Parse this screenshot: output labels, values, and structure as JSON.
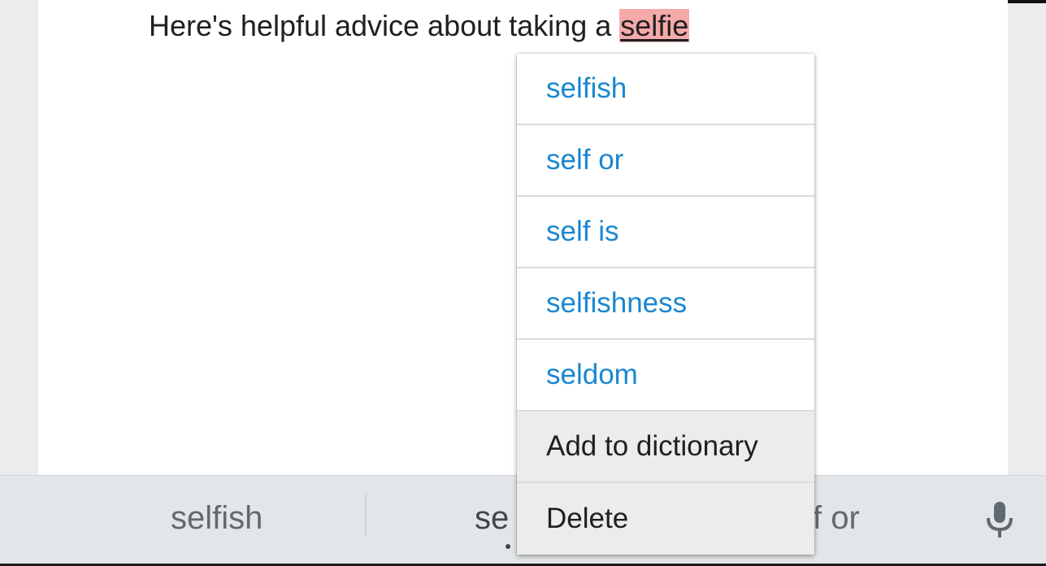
{
  "document": {
    "text_before": "Here's helpful advice about taking a ",
    "misspelled_word": "selfie"
  },
  "context_menu": {
    "suggestions": [
      "selfish",
      "self or",
      "self is",
      "selfishness",
      "seldom"
    ],
    "add_to_dictionary_label": "Add to dictionary",
    "delete_label": "Delete"
  },
  "suggestion_strip": {
    "left": "selfish",
    "center": "se",
    "right": "f or",
    "mic_icon": "microphone-icon"
  },
  "colors": {
    "suggestion_text": "#1a87d0",
    "misspelling_highlight": "#f6a9a9",
    "keyboard_strip": "#e3e6e8"
  }
}
